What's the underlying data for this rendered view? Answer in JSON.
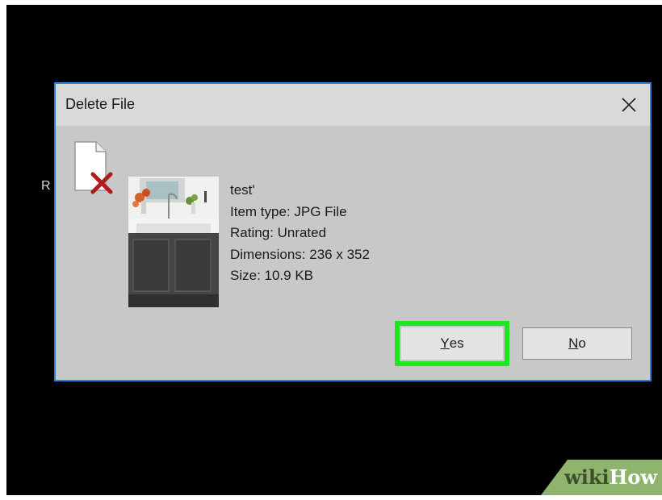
{
  "dialog": {
    "title": "Delete File",
    "close_icon": "close-icon",
    "file_icon": "file-delete-icon",
    "thumbnail_alt": "kitchen-sink-photo",
    "file": {
      "name": "test'",
      "item_type": "Item type: JPG File",
      "rating": "Rating: Unrated",
      "dimensions": "Dimensions: 236 x 352",
      "size": "Size: 10.9 KB"
    },
    "buttons": {
      "yes_mnemonic": "Y",
      "yes_rest": "es",
      "no_mnemonic": "N",
      "no_rest": "o"
    }
  },
  "background": {
    "partial_text": "R"
  },
  "watermark": {
    "part1": "wiki",
    "part2": "How"
  },
  "colors": {
    "dialog_bg": "#c8c8c8",
    "titlebar_bg": "#d9d9d9",
    "dialog_border": "#2b82d9",
    "highlight": "#1ee51e",
    "watermark_green": "#8fb46e"
  }
}
